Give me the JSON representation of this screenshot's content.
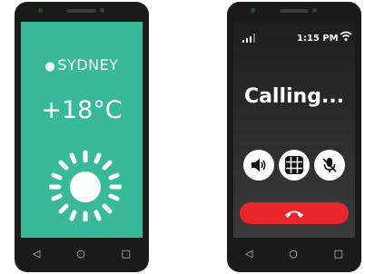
{
  "weather": {
    "city": "SYDNEY",
    "pin_icon": "location-pin-icon",
    "temperature": "+18°C",
    "condition_icon": "sun-icon",
    "background": "#37b99a"
  },
  "call": {
    "time": "1:15 PM",
    "status": "Calling...",
    "buttons": [
      "speaker-icon",
      "keypad-icon",
      "mute-icon"
    ],
    "hangup_color": "#e8262b"
  },
  "navbar": {
    "back": "◁",
    "home": "○",
    "recents": "□"
  }
}
